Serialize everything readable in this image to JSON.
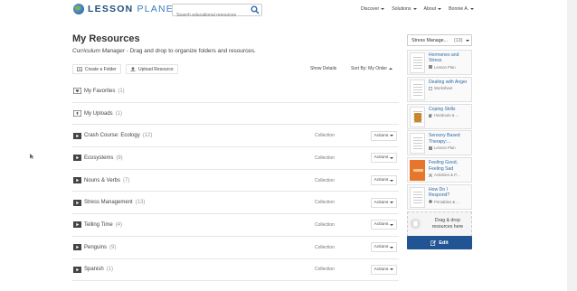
{
  "header": {
    "logo_text_a": "LESSON",
    "logo_text_b": "PLANET",
    "search_placeholder": "Search educational resources",
    "nav": [
      {
        "label": "Discover"
      },
      {
        "label": "Solutions"
      },
      {
        "label": "About"
      },
      {
        "label": "Bonnie A."
      }
    ]
  },
  "page": {
    "title": "My Resources",
    "subtitle_role": "Curriculum Manager",
    "subtitle_text": " - Drag and drop to organize folders and resources."
  },
  "toolbar": {
    "create_folder": "Create a Folder",
    "upload_resource": "Upload Resource",
    "show_details": "Show Details",
    "sort_by": "Sort By: My Order"
  },
  "rows": [
    {
      "name": "My Favorites",
      "count": "(1)",
      "kind": "",
      "actions": ""
    },
    {
      "name": "My Uploads",
      "count": "(1)",
      "kind": "",
      "actions": ""
    },
    {
      "name": "Crash Course: Ecology",
      "count": "(12)",
      "kind": "Collection",
      "actions": "Actions"
    },
    {
      "name": "Ecosystems",
      "count": "(8)",
      "kind": "Collection",
      "actions": "Actions"
    },
    {
      "name": "Nouns & Verbs",
      "count": "(7)",
      "kind": "Collection",
      "actions": "Actions"
    },
    {
      "name": "Stress Management",
      "count": "(13)",
      "kind": "Collection",
      "actions": "Actions"
    },
    {
      "name": "Telling Time",
      "count": "(4)",
      "kind": "Collection",
      "actions": "Actions"
    },
    {
      "name": "Penguins",
      "count": "(9)",
      "kind": "Collection",
      "actions": "Actions"
    },
    {
      "name": "Spanish",
      "count": "(1)",
      "kind": "Collection",
      "actions": "Actions"
    }
  ],
  "panel": {
    "selected": "Stress Manage...",
    "selected_count": "(13)",
    "cards": [
      {
        "title": "Hormones and Stress",
        "type": "Lesson Plan",
        "thumb": "plain"
      },
      {
        "title": "Dealing with Anger",
        "type": "Worksheet",
        "thumb": "plain"
      },
      {
        "title": "Coping Skills",
        "type": "Handouts & ...",
        "thumb": "dark"
      },
      {
        "title": "Sensory Based Therapy:...",
        "type": "Lesson Plan",
        "thumb": "plain"
      },
      {
        "title": "Feeling Good, Feeling Sad",
        "type": "Activities & P...",
        "thumb": "orange"
      },
      {
        "title": "How Do I Respond?",
        "type": "Printables & ...",
        "thumb": "plain"
      }
    ],
    "dropzone_text": "Drag & drop resources here",
    "edit_label": "Edit"
  },
  "colors": {
    "accent": "#205493",
    "link": "#2d6aa5"
  }
}
